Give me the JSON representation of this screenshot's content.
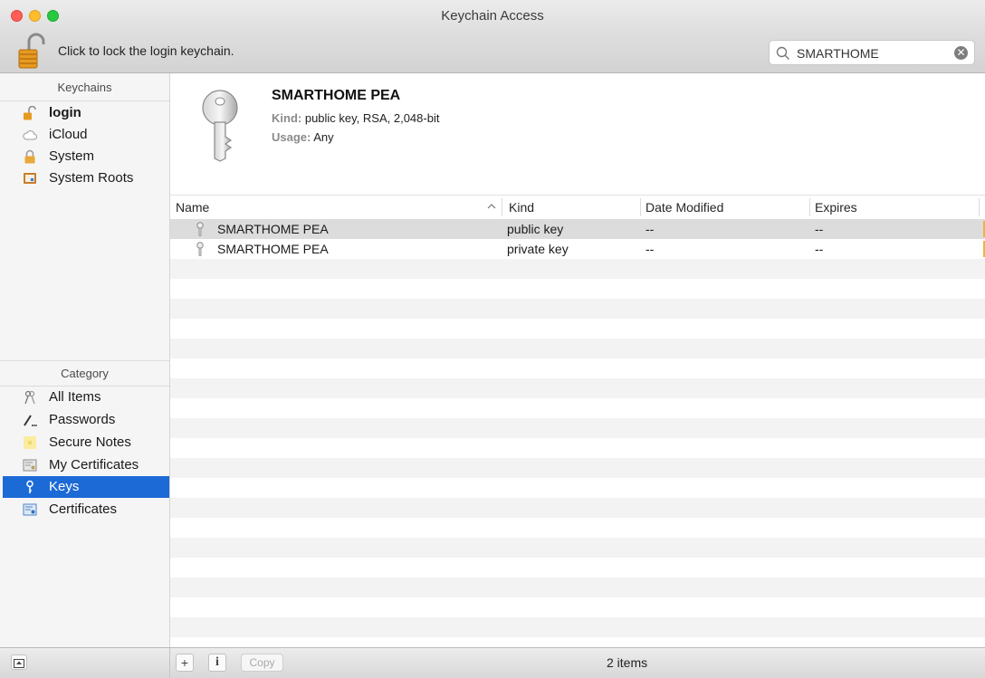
{
  "window": {
    "title": "Keychain Access"
  },
  "toolbar": {
    "lock_message": "Click to lock the login keychain.",
    "search_value": "SMARTHOME",
    "search_placeholder": "Search"
  },
  "sidebar": {
    "keychains_header": "Keychains",
    "keychains": [
      {
        "label": "login",
        "icon": "unlocked-padlock-icon",
        "bold": true
      },
      {
        "label": "iCloud",
        "icon": "cloud-icon"
      },
      {
        "label": "System",
        "icon": "padlock-icon"
      },
      {
        "label": "System Roots",
        "icon": "certificate-folder-icon"
      }
    ],
    "category_header": "Category",
    "categories": [
      {
        "label": "All Items",
        "icon": "keys-icon"
      },
      {
        "label": "Passwords",
        "icon": "pen-icon"
      },
      {
        "label": "Secure Notes",
        "icon": "note-icon"
      },
      {
        "label": "My Certificates",
        "icon": "certificate-icon"
      },
      {
        "label": "Keys",
        "icon": "key-icon",
        "selected": true
      },
      {
        "label": "Certificates",
        "icon": "certificate-icon"
      }
    ]
  },
  "detail": {
    "name": "SMARTHOME PEA",
    "kind_label": "Kind:",
    "kind_value": "public key, RSA, 2,048-bit",
    "usage_label": "Usage:",
    "usage_value": "Any"
  },
  "table": {
    "columns": {
      "name": "Name",
      "kind": "Kind",
      "date_modified": "Date Modified",
      "expires": "Expires"
    },
    "rows": [
      {
        "name": "SMARTHOME PEA",
        "kind": "public key",
        "date_modified": "--",
        "expires": "--",
        "selected": true
      },
      {
        "name": "SMARTHOME PEA",
        "kind": "private key",
        "date_modified": "--",
        "expires": "--"
      }
    ]
  },
  "bottombar": {
    "add_label": "+",
    "info_label": "i",
    "copy_label": "Copy",
    "status": "2 items"
  },
  "colors": {
    "selection": "#1c6ad6",
    "close": "#ff5f57",
    "minimize": "#ffbd2e",
    "maximize": "#28c940"
  }
}
